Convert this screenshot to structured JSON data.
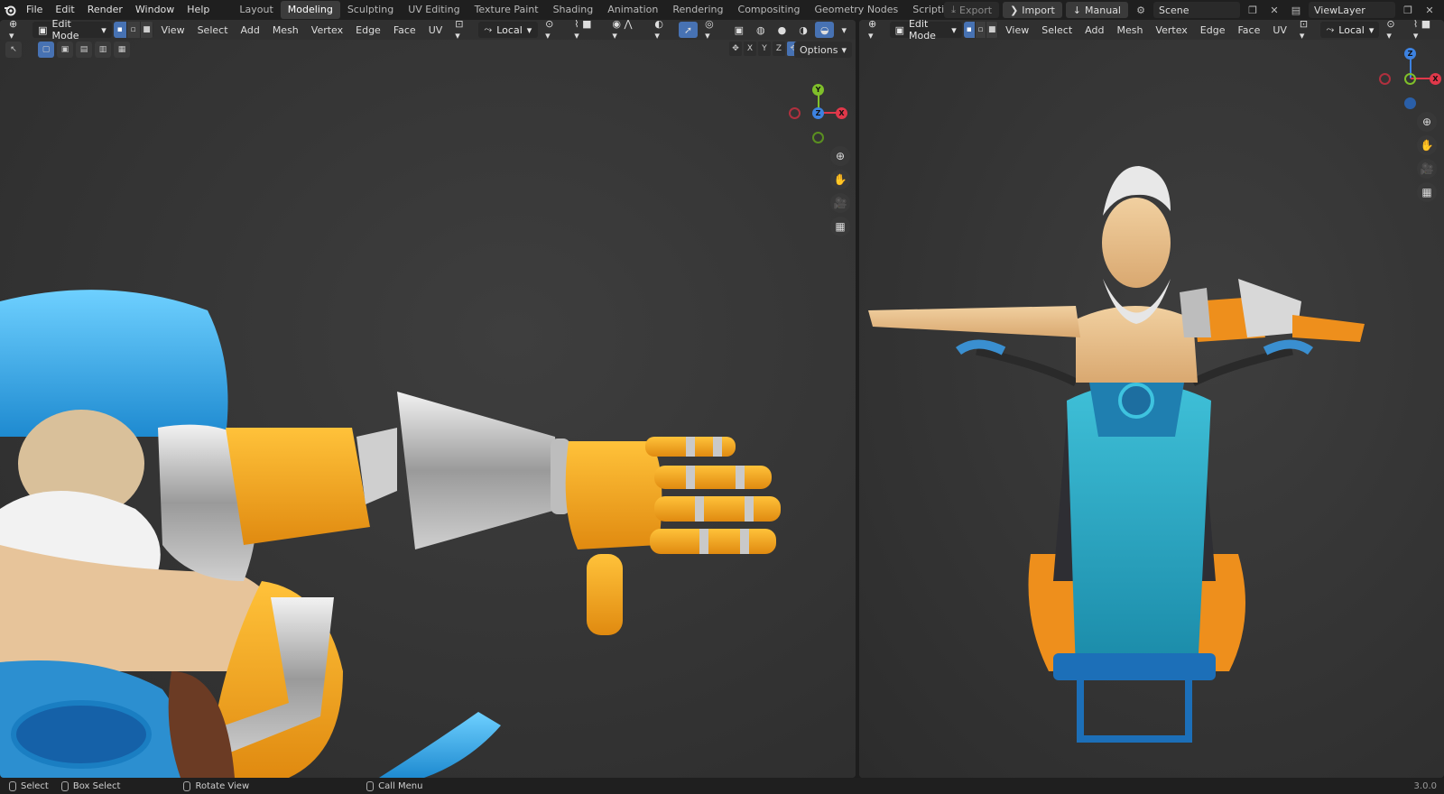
{
  "app": {
    "name": "Blender",
    "version": "3.0.0"
  },
  "menu": [
    "File",
    "Edit",
    "Render",
    "Window",
    "Help"
  ],
  "workspaces": [
    "Layout",
    "Modeling",
    "Sculpting",
    "UV Editing",
    "Texture Paint",
    "Shading",
    "Animation",
    "Rendering",
    "Compositing",
    "Geometry Nodes",
    "Scripting"
  ],
  "active_workspace": "Modeling",
  "topright": {
    "export": "Export",
    "import": "Import",
    "manual": "Manual",
    "scene": "Scene",
    "view_layer": "ViewLayer"
  },
  "left_view": {
    "mode": "Edit Mode",
    "menus": [
      "View",
      "Select",
      "Add",
      "Mesh",
      "Vertex",
      "Edge",
      "Face",
      "UV"
    ],
    "transform_orientation": "Local",
    "options_label": "Options",
    "mirror_axes": [
      "X",
      "Y",
      "Z"
    ],
    "gizmo": {
      "x": "X",
      "y": "Y",
      "z": "Z"
    }
  },
  "right_view": {
    "mode": "Edit Mode",
    "menus": [
      "View",
      "Select",
      "Add",
      "Mesh",
      "Vertex",
      "Edge",
      "Face",
      "UV"
    ],
    "transform_orientation": "Local"
  },
  "status": {
    "select": "Select",
    "box_select": "Box Select",
    "rotate": "Rotate View",
    "call_menu": "Call Menu",
    "version": "3.0.0"
  },
  "colors": {
    "accent": "#4772b3",
    "axis_x": "#e0384a",
    "axis_y": "#7fbf2a",
    "axis_z": "#3d82e0"
  }
}
